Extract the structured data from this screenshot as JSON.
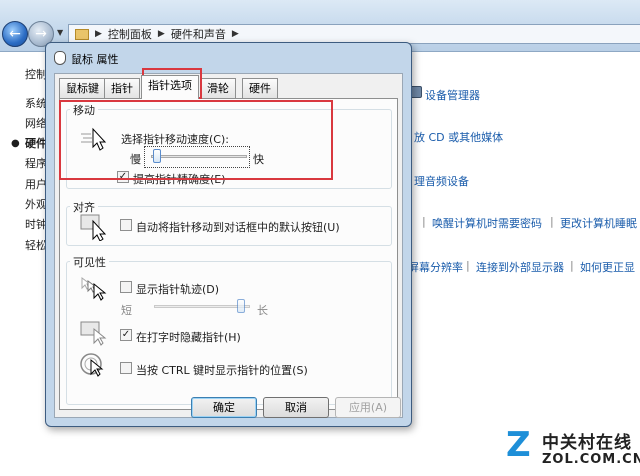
{
  "background_window": {
    "breadcrumb": [
      "控制面板",
      "硬件和声音"
    ],
    "left_nav": [
      "控制",
      "系统",
      "网络",
      "硬件",
      "程序",
      "用户",
      "外观",
      "时钟",
      "轻松"
    ],
    "links": {
      "device_manager": "设备管理器",
      "cd_media": "放 CD 或其他媒体",
      "audio_devices": "理音频设备",
      "wake_password": "唤醒计算机时需要密码",
      "change_sleep": "更改计算机睡眠",
      "resolution": "屏幕分辨率",
      "external_display": "连接到外部显示器",
      "how_correct": "如何更正显"
    }
  },
  "dialog": {
    "title": "鼠标 属性",
    "tabs": [
      "鼠标键",
      "指针",
      "指针选项",
      "滑轮",
      "硬件"
    ],
    "active_tab": "指针选项",
    "motion": {
      "label": "移动",
      "speed_label": "选择指针移动速度(C):",
      "slow": "慢",
      "fast": "快",
      "speed_value": 0.03,
      "precision_label": "提高指针精确度(E)",
      "precision_checked": true
    },
    "snap_to": {
      "label": "对齐",
      "checkbox_label": "自动将指针移动到对话框中的默认按钮(U)",
      "checked": false
    },
    "visibility": {
      "label": "可见性",
      "trails_label": "显示指针轨迹(D)",
      "trails_checked": false,
      "short": "短",
      "long": "长",
      "trails_value": 0.95,
      "hide_typing_label": "在打字时隐藏指针(H)",
      "hide_typing_checked": true,
      "ctrl_show_label": "当按 CTRL 键时显示指针的位置(S)",
      "ctrl_show_checked": false
    },
    "buttons": {
      "ok": "确定",
      "cancel": "取消",
      "apply": "应用(A)"
    }
  },
  "watermark": {
    "cn": "中关村在线",
    "en": "ZOL.COM.CN"
  },
  "colors": {
    "highlight": "#d9383f",
    "link": "#1a5cab",
    "logo_blue": "#1e8fd8"
  }
}
